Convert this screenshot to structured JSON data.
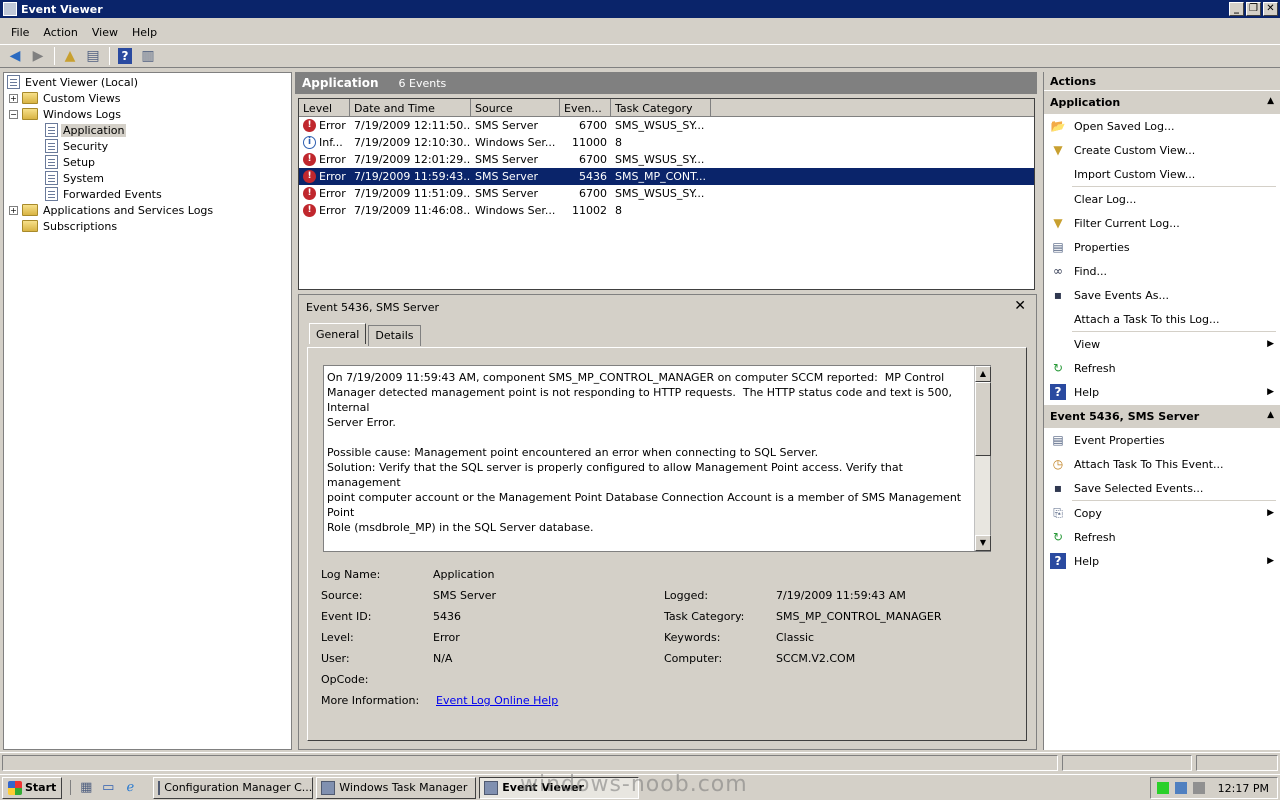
{
  "window": {
    "title": "Event Viewer"
  },
  "menu": [
    "File",
    "Action",
    "View",
    "Help"
  ],
  "tree": {
    "root": "Event Viewer (Local)",
    "custom_views": "Custom Views",
    "windows_logs": "Windows Logs",
    "logs": [
      "Application",
      "Security",
      "Setup",
      "System",
      "Forwarded Events"
    ],
    "apps_services": "Applications and Services Logs",
    "subscriptions": "Subscriptions"
  },
  "center": {
    "title": "Application",
    "count": "6 Events",
    "columns": [
      "Level",
      "Date and Time",
      "Source",
      "Even...",
      "Task Category"
    ],
    "rows": [
      {
        "level": "Error",
        "icon": "error",
        "date": "7/19/2009 12:11:50...",
        "source": "SMS Server",
        "event_id": "6700",
        "category": "SMS_WSUS_SY..."
      },
      {
        "level": "Inf...",
        "icon": "info",
        "date": "7/19/2009 12:10:30...",
        "source": "Windows Ser...",
        "event_id": "11000",
        "category": "8"
      },
      {
        "level": "Error",
        "icon": "error",
        "date": "7/19/2009 12:01:29...",
        "source": "SMS Server",
        "event_id": "6700",
        "category": "SMS_WSUS_SY..."
      },
      {
        "level": "Error",
        "icon": "error",
        "date": "7/19/2009 11:59:43...",
        "source": "SMS Server",
        "event_id": "5436",
        "category": "SMS_MP_CONT..."
      },
      {
        "level": "Error",
        "icon": "error",
        "date": "7/19/2009 11:51:09...",
        "source": "SMS Server",
        "event_id": "6700",
        "category": "SMS_WSUS_SY..."
      },
      {
        "level": "Error",
        "icon": "error",
        "date": "7/19/2009 11:46:08...",
        "source": "Windows Ser...",
        "event_id": "11002",
        "category": "8"
      }
    ]
  },
  "detail": {
    "title": "Event 5436, SMS Server",
    "tabs": [
      "General",
      "Details"
    ],
    "description": "On 7/19/2009 11:59:43 AM, component SMS_MP_CONTROL_MANAGER on computer SCCM reported:  MP Control\nManager detected management point is not responding to HTTP requests.  The HTTP status code and text is 500, Internal\nServer Error.\n\nPossible cause: Management point encountered an error when connecting to SQL Server.\nSolution: Verify that the SQL server is properly configured to allow Management Point access. Verify that management\npoint computer account or the Management Point Database Connection Account is a member of SMS Management Point\nRole (msdbrole_MP) in the SQL Server database.\n\nPossible cause:  The SQL Server Service Principal Names (SPNs) are not registered correctly in Active Directory\nSolution:  Ensure SQL server SPNs are correctly registered.  Review Q829868.\n\nPossible cause: Internet Information Services (IIS) isn't configured to listen on the ports over which SMS is configured",
    "labels": {
      "log_name": "Log Name:",
      "source": "Source:",
      "event_id": "Event ID:",
      "level": "Level:",
      "user": "User:",
      "opcode": "OpCode:",
      "more_info": "More Information:",
      "logged": "Logged:",
      "task_category": "Task Category:",
      "keywords": "Keywords:",
      "computer": "Computer:"
    },
    "values": {
      "log_name": "Application",
      "source": "SMS Server",
      "event_id": "5436",
      "level": "Error",
      "user": "N/A",
      "opcode": "",
      "more_info": "Event Log Online Help",
      "logged": "7/19/2009 11:59:43 AM",
      "task_category": "SMS_MP_CONTROL_MANAGER",
      "keywords": "Classic",
      "computer": "SCCM.V2.COM"
    }
  },
  "actions": {
    "header": "Actions",
    "section1": "Application",
    "items1": [
      {
        "label": "Open Saved Log...",
        "icon": "open-folder-icon"
      },
      {
        "label": "Create Custom View...",
        "icon": "filter-icon"
      },
      {
        "label": "Import Custom View...",
        "icon": ""
      },
      {
        "label": "Clear Log...",
        "icon": ""
      },
      {
        "label": "Filter Current Log...",
        "icon": "filter-icon"
      },
      {
        "label": "Properties",
        "icon": "properties-icon"
      },
      {
        "label": "Find...",
        "icon": "binoculars-icon"
      },
      {
        "label": "Save Events As...",
        "icon": "disk-icon"
      },
      {
        "label": "Attach a Task To this Log...",
        "icon": ""
      },
      {
        "label": "View",
        "icon": ""
      },
      {
        "label": "Refresh",
        "icon": "refresh-icon"
      },
      {
        "label": "Help",
        "icon": "help-icon"
      }
    ],
    "section2": "Event 5436, SMS Server",
    "items2": [
      {
        "label": "Event Properties",
        "icon": "properties-icon"
      },
      {
        "label": "Attach Task To This Event...",
        "icon": "task-icon"
      },
      {
        "label": "Save Selected Events...",
        "icon": "disk-icon"
      },
      {
        "label": "Copy",
        "icon": "copy-icon"
      },
      {
        "label": "Refresh",
        "icon": "refresh-icon"
      },
      {
        "label": "Help",
        "icon": "help-icon"
      }
    ]
  },
  "taskbar": {
    "start": "Start",
    "tasks": [
      "Configuration Manager C...",
      "Windows Task Manager",
      "Event Viewer"
    ],
    "clock": "12:17 PM",
    "watermark": "windows-noob.com"
  }
}
